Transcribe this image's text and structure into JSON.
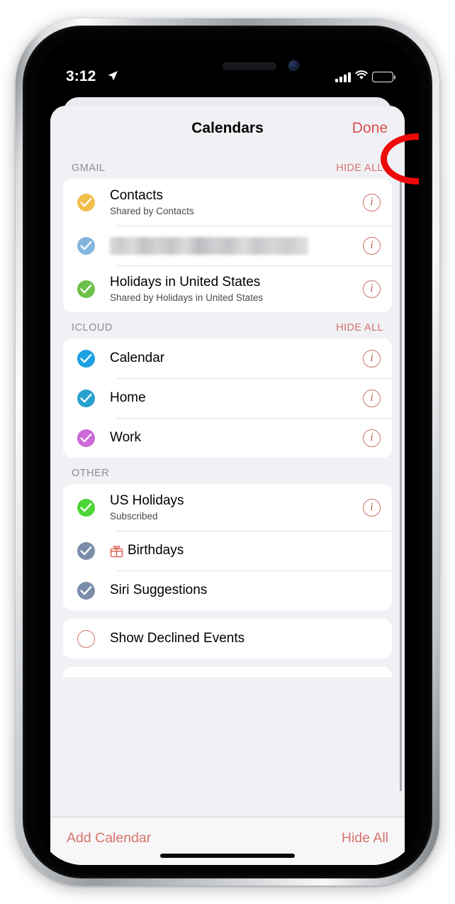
{
  "status_bar": {
    "time": "3:12",
    "location_icon": "location-arrow-icon",
    "signal_icon": "cellular-bars-icon",
    "wifi_icon": "wifi-icon",
    "battery_icon": "battery-icon",
    "battery_level_pct": 70
  },
  "header": {
    "title": "Calendars",
    "done_label": "Done"
  },
  "annotation": {
    "shape": "ellipse-highlight",
    "target": "Done",
    "color": "#ed0909"
  },
  "sections": [
    {
      "title": "GMAIL",
      "action_label": "HIDE ALL",
      "rows": [
        {
          "title": "Contacts",
          "subtitle": "Shared by Contacts",
          "checked": true,
          "color": "#f0be4b",
          "info": true,
          "blurred": false,
          "leading_icon": ""
        },
        {
          "title": "",
          "subtitle": "",
          "checked": true,
          "color": "#82b5de",
          "info": true,
          "blurred": true,
          "leading_icon": ""
        },
        {
          "title": "Holidays in United States",
          "subtitle": "Shared by Holidays in United States",
          "checked": true,
          "color": "#6cc04a",
          "info": true,
          "blurred": false,
          "leading_icon": ""
        }
      ]
    },
    {
      "title": "ICLOUD",
      "action_label": "HIDE ALL",
      "rows": [
        {
          "title": "Calendar",
          "subtitle": "",
          "checked": true,
          "color": "#1ca1e2",
          "info": true,
          "blurred": false,
          "leading_icon": ""
        },
        {
          "title": "Home",
          "subtitle": "",
          "checked": true,
          "color": "#26a0ce",
          "info": true,
          "blurred": false,
          "leading_icon": ""
        },
        {
          "title": "Work",
          "subtitle": "",
          "checked": true,
          "color": "#cc6ad8",
          "info": true,
          "blurred": false,
          "leading_icon": ""
        }
      ]
    },
    {
      "title": "OTHER",
      "action_label": "",
      "rows": [
        {
          "title": "US Holidays",
          "subtitle": "Subscribed",
          "checked": true,
          "color": "#4cd536",
          "info": true,
          "blurred": false,
          "leading_icon": ""
        },
        {
          "title": "Birthdays",
          "subtitle": "",
          "checked": true,
          "color": "#7b8da8",
          "info": false,
          "blurred": false,
          "leading_icon": "gift-icon"
        },
        {
          "title": "Siri Suggestions",
          "subtitle": "",
          "checked": true,
          "color": "#7b8da8",
          "info": false,
          "blurred": false,
          "leading_icon": ""
        }
      ]
    }
  ],
  "options": {
    "show_declined_label": "Show Declined Events",
    "show_declined_checked": false
  },
  "toolbar": {
    "add_calendar_label": "Add Calendar",
    "hide_all_label": "Hide All"
  }
}
